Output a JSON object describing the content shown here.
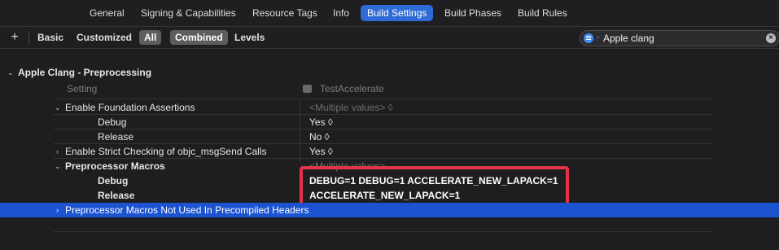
{
  "tabs": [
    "General",
    "Signing & Capabilities",
    "Resource Tags",
    "Info",
    "Build Settings",
    "Build Phases",
    "Build Rules"
  ],
  "filters": {
    "plus": "+",
    "basic": "Basic",
    "customized": "Customized",
    "all": "All",
    "combined": "Combined",
    "levels": "Levels"
  },
  "search": {
    "value": "Apple clang",
    "clear": "⊗"
  },
  "section": {
    "title": "Apple Clang - Preprocessing",
    "col_setting": "Setting",
    "col_target": "TestAccelerate"
  },
  "rows": {
    "foundation": {
      "label": "Enable Foundation Assertions",
      "value": "<Multiple values> ◊"
    },
    "foundation_debug": {
      "label": "Debug",
      "value": "Yes ◊"
    },
    "foundation_release": {
      "label": "Release",
      "value": "No ◊"
    },
    "strict": {
      "label": "Enable Strict Checking of objc_msgSend Calls",
      "value": "Yes ◊"
    },
    "macros": {
      "label": "Preprocessor Macros",
      "value": "<Multiple values>"
    },
    "macros_debug": {
      "label": "Debug",
      "value": "DEBUG=1 DEBUG=1  ACCELERATE_NEW_LAPACK=1"
    },
    "macros_release": {
      "label": "Release",
      "value": "ACCELERATE_NEW_LAPACK=1"
    },
    "not_used": {
      "label": "Preprocessor Macros Not Used In Precompiled Headers"
    }
  },
  "colors": {
    "accent": "#2e6bd6",
    "selection": "#1b53d0",
    "highlight": "#e3334a"
  }
}
